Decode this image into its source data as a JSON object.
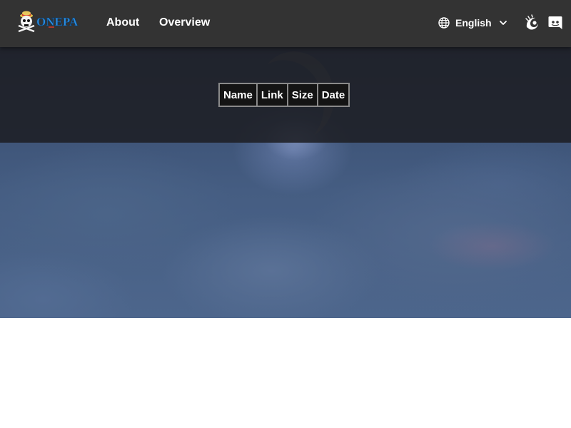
{
  "header": {
    "logo_text": "ONEPACE",
    "nav": [
      {
        "label": "About"
      },
      {
        "label": "Overview"
      }
    ],
    "language": {
      "label": "English",
      "icon": "globe-icon",
      "dropdown_icon": "chevron-down-icon"
    },
    "social": [
      {
        "icon": "crunchyroll-icon"
      },
      {
        "icon": "discord-icon"
      }
    ]
  },
  "table": {
    "columns": [
      "Name",
      "Link",
      "Size",
      "Date"
    ],
    "rows": []
  },
  "colors": {
    "header_bg": "#333333",
    "overlay_bg": "#1e1f24",
    "sky": "#455d82",
    "text": "#ffffff"
  }
}
